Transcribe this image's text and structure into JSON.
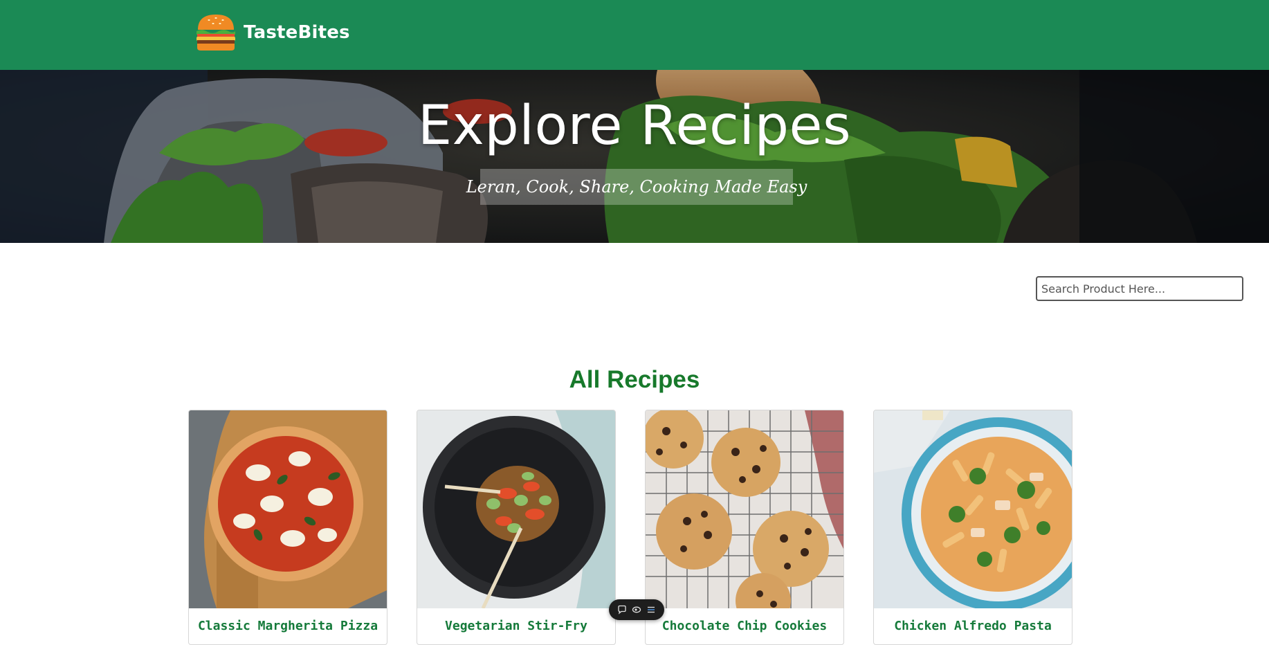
{
  "header": {
    "brand_name": "TasteBites",
    "logo_icon": "burger-icon",
    "bg_color": "#1b8a55"
  },
  "hero": {
    "title": "Explore Recipes",
    "subtitle": "Leran, Cook, Share, Cooking Made Easy"
  },
  "search": {
    "placeholder": "Search Product Here..."
  },
  "recipes_section": {
    "title": "All Recipes",
    "title_color": "#17792b",
    "cards": [
      {
        "title": "Classic Margherita Pizza",
        "image": "pizza-photo"
      },
      {
        "title": "Vegetarian Stir-Fry",
        "image": "stir-fry-photo"
      },
      {
        "title": "Chocolate Chip Cookies",
        "image": "cookies-photo"
      },
      {
        "title": "Chicken Alfredo Pasta",
        "image": "pasta-photo"
      }
    ]
  },
  "floating_toolbar": {
    "buttons": [
      "comment-icon",
      "view-icon",
      "list-icon"
    ]
  }
}
